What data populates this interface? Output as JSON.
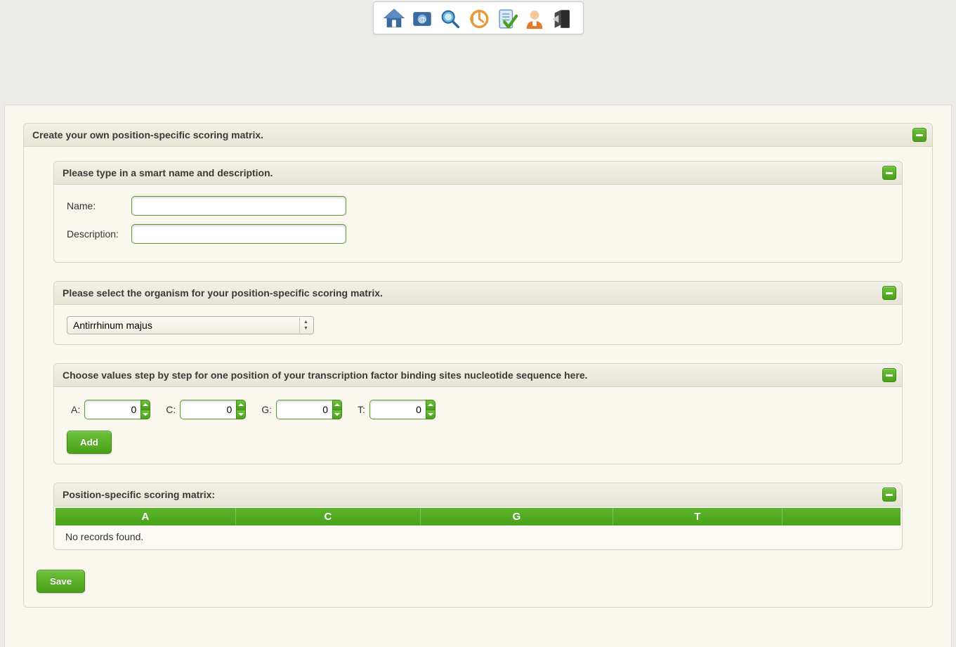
{
  "toolbar": {
    "icons": [
      "home-icon",
      "mail-icon",
      "search-icon",
      "history-icon",
      "task-icon",
      "user-icon",
      "logout-icon"
    ]
  },
  "main_panel": {
    "title": "Create your own position-specific scoring matrix."
  },
  "section_name": {
    "title": "Please type in a smart name and description.",
    "name_label": "Name:",
    "description_label": "Description:",
    "name_value": "",
    "description_value": ""
  },
  "section_organism": {
    "title": "Please select the organism for your position-specific scoring matrix.",
    "selected": "Antirrhinum majus"
  },
  "section_values": {
    "title": "Choose values step by step for one position of your transcription factor binding sites nucleotide sequence here.",
    "labels": {
      "a": "A:",
      "c": "C:",
      "g": "G:",
      "t": "T:"
    },
    "values": {
      "a": "0",
      "c": "0",
      "g": "0",
      "t": "0"
    },
    "add_button": "Add"
  },
  "section_matrix": {
    "title": "Position-specific scoring matrix:",
    "columns": [
      "A",
      "C",
      "G",
      "T"
    ],
    "empty_message": "No records found."
  },
  "save_button": "Save"
}
